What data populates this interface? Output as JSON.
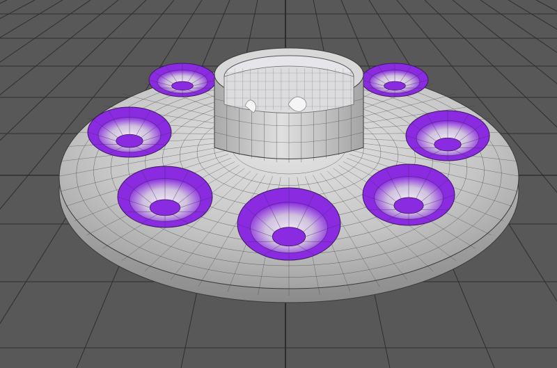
{
  "viewport": {
    "background_color": "#585858",
    "grid_color": "#2e2e2e",
    "grid_main_axis_color": "#1a1a1a",
    "grid_visible": true
  },
  "model": {
    "description_icon": "ufo-saucer-mesh-icon",
    "wireframe_visible": true,
    "body_color": "#c9c9c9",
    "wire_color": "#3a3a3a",
    "selection_color": "#8a2be2",
    "selected_port_count": 8,
    "dome_glass_color": "#d9d9dc"
  }
}
